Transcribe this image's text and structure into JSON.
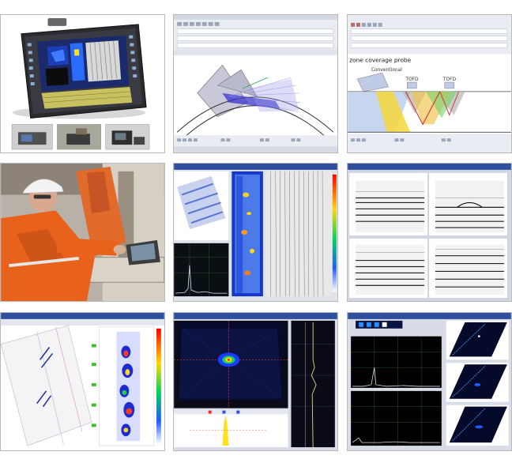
{
  "gallery": {
    "tiles": [
      {
        "id": "tile-1",
        "name": "portable-flaw-detector-photo",
        "caption": ""
      },
      {
        "id": "tile-2",
        "name": "beam-simulation-software",
        "caption": ""
      },
      {
        "id": "tile-3",
        "name": "zone-coverage-probe-software",
        "caption": "zone coverage probe",
        "label_a": "Conventional",
        "label_b": "TOFD",
        "label_c": "TOFD"
      },
      {
        "id": "tile-4",
        "name": "field-inspection-technicians-photo",
        "caption": ""
      },
      {
        "id": "tile-5",
        "name": "cscan-data-analysis",
        "caption": ""
      },
      {
        "id": "tile-6",
        "name": "multi-channel-bscan",
        "caption": ""
      },
      {
        "id": "tile-7",
        "name": "sector-scan-weld-view",
        "caption": ""
      },
      {
        "id": "tile-8",
        "name": "single-indication-scan",
        "caption": ""
      },
      {
        "id": "tile-9",
        "name": "multi-view-analysis",
        "caption": ""
      }
    ]
  },
  "colors": {
    "frame": "#b9b9b9",
    "orange_coverall": "#e8621c",
    "helmet": "#f3f3f3",
    "toolbar": "#e9ecf2",
    "scan_dark": "#0b0b18",
    "cscan_blue": "#1637c9"
  }
}
